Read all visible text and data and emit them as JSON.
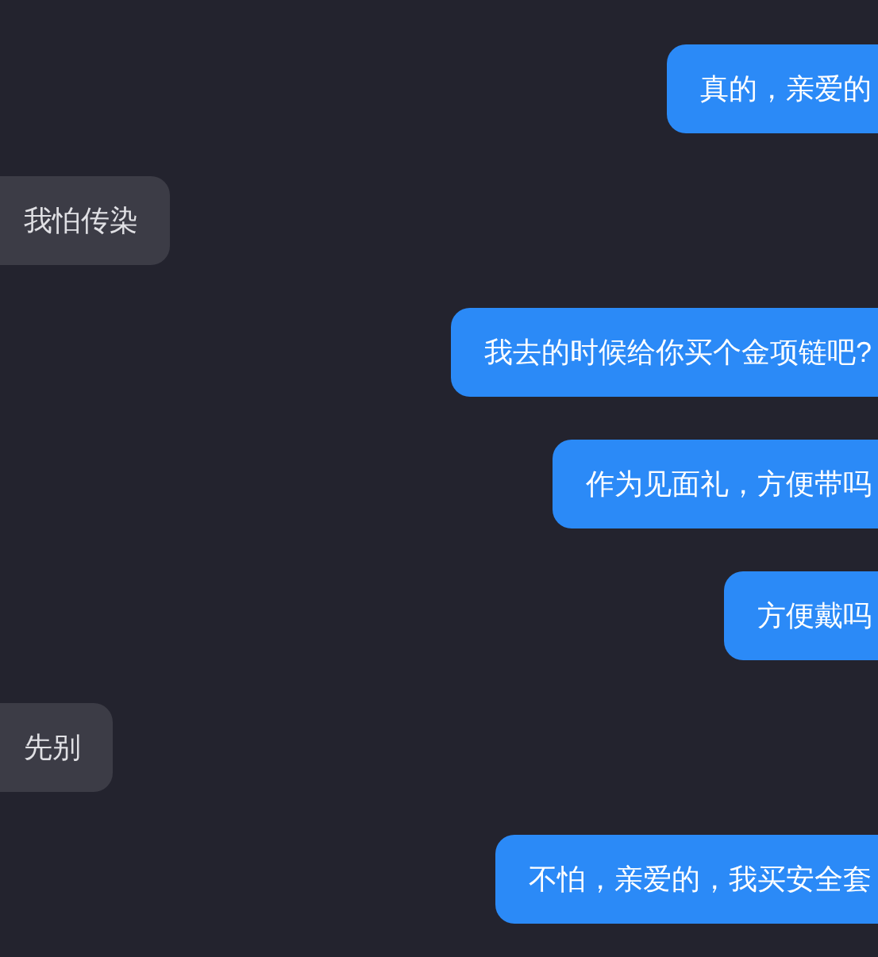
{
  "messages": [
    {
      "kind": "sent",
      "text": "真的，亲爱的"
    },
    {
      "kind": "received",
      "text": "我怕传染"
    },
    {
      "kind": "sent",
      "text": "我去的时候给你买个金项链吧?"
    },
    {
      "kind": "sent",
      "text": "作为见面礼，方便带吗"
    },
    {
      "kind": "sent",
      "text": "方便戴吗"
    },
    {
      "kind": "received",
      "text": "先别"
    },
    {
      "kind": "sent",
      "text": "不怕，亲爱的，我买安全套"
    }
  ]
}
